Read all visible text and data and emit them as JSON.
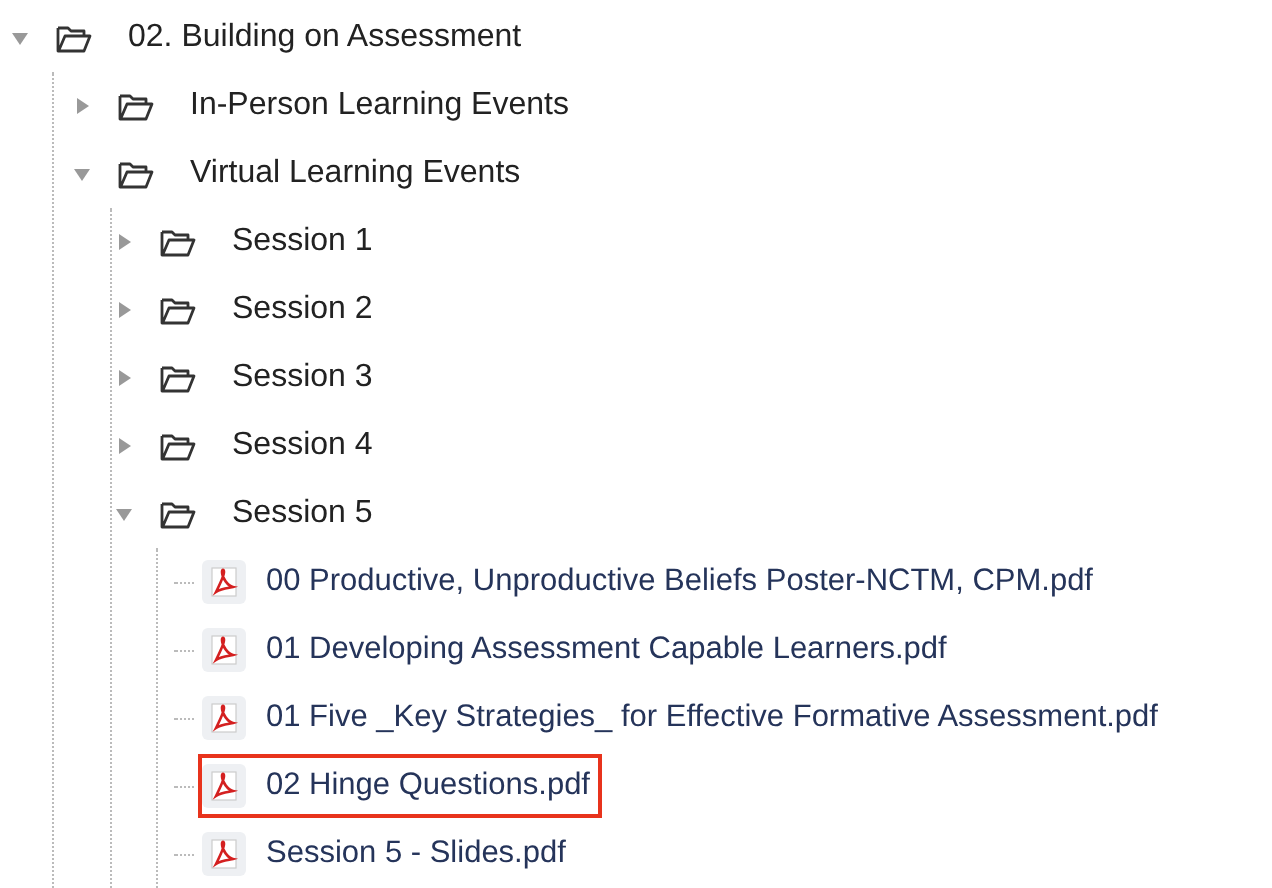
{
  "tree": [
    {
      "kind": "folder",
      "label": "02. Building on Assessment",
      "expanded": true,
      "children": [
        {
          "kind": "folder",
          "label": "In-Person Learning Events",
          "expanded": false
        },
        {
          "kind": "folder",
          "label": "Virtual Learning Events",
          "expanded": true,
          "children": [
            {
              "kind": "folder",
              "label": "Session 1",
              "expanded": false
            },
            {
              "kind": "folder",
              "label": "Session 2",
              "expanded": false
            },
            {
              "kind": "folder",
              "label": "Session 3",
              "expanded": false
            },
            {
              "kind": "folder",
              "label": "Session 4",
              "expanded": false
            },
            {
              "kind": "folder",
              "label": "Session 5",
              "expanded": true,
              "children": [
                {
                  "kind": "file",
                  "label": "00 Productive, Unproductive Beliefs Poster-NCTM, CPM.pdf",
                  "highlighted": false
                },
                {
                  "kind": "file",
                  "label": "01 Developing Assessment Capable Learners.pdf",
                  "highlighted": false
                },
                {
                  "kind": "file",
                  "label": "01 Five _Key Strategies_ for Effective Formative Assessment.pdf",
                  "highlighted": false
                },
                {
                  "kind": "file",
                  "label": "02 Hinge Questions.pdf",
                  "highlighted": true
                },
                {
                  "kind": "file",
                  "label": "Session 5 - Slides.pdf",
                  "highlighted": false
                }
              ]
            }
          ]
        }
      ]
    }
  ]
}
